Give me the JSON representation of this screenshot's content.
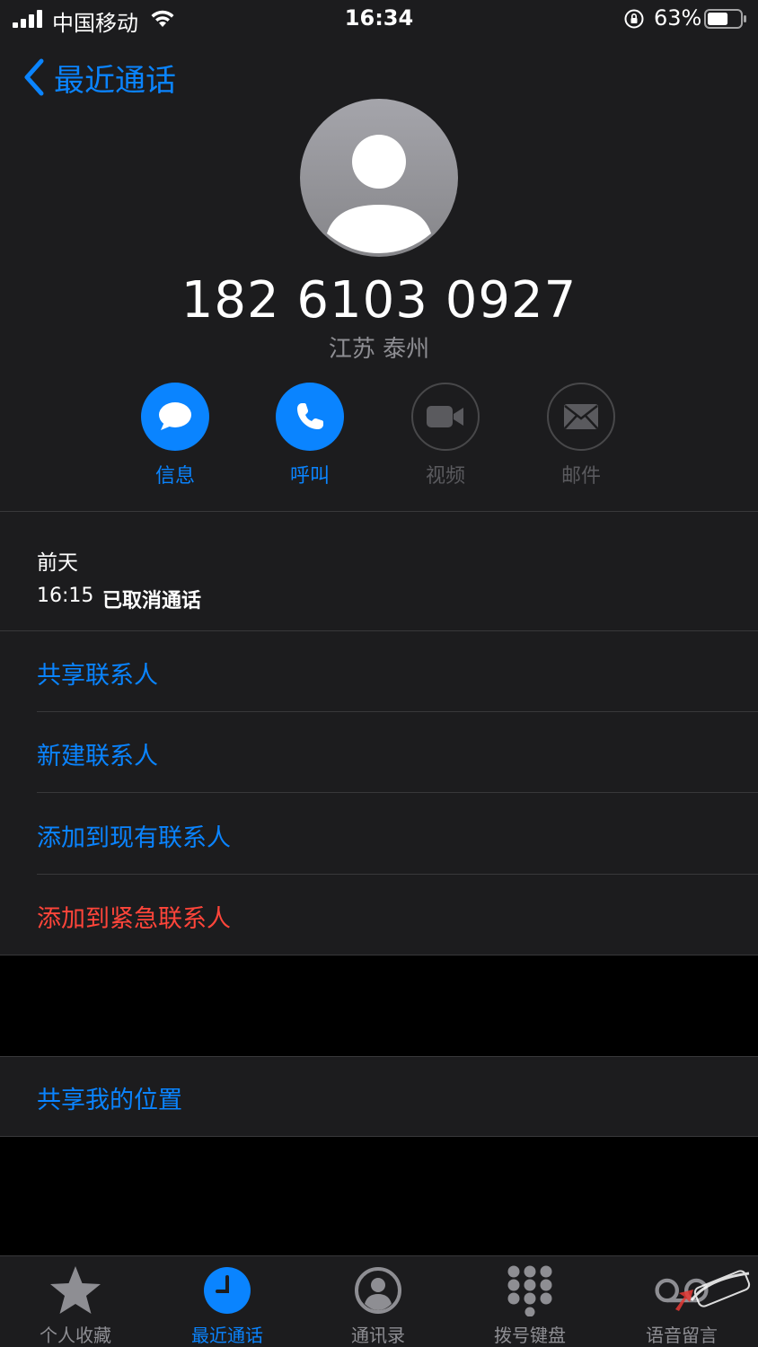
{
  "status_bar": {
    "carrier": "中国移动",
    "time": "16:34",
    "battery_percent": "63%",
    "battery_level": 0.63
  },
  "nav": {
    "back_label": "最近通话",
    "accent_color": "#0a84ff"
  },
  "contact": {
    "avatar_icon": "person-silhouette-icon",
    "phone_number": "182 6103 0927",
    "location": "江苏 泰州"
  },
  "actions": [
    {
      "label": "信息",
      "icon": "message-bubble-icon",
      "enabled": true
    },
    {
      "label": "呼叫",
      "icon": "phone-icon",
      "enabled": true
    },
    {
      "label": "视频",
      "icon": "video-camera-icon",
      "enabled": false
    },
    {
      "label": "邮件",
      "icon": "envelope-icon",
      "enabled": false
    }
  ],
  "recent_call": {
    "date": "前天",
    "time": "16:15",
    "status": "已取消通话"
  },
  "menu": {
    "share_contact": "共享联系人",
    "new_contact": "新建联系人",
    "add_existing": "添加到现有联系人",
    "add_emergency": "添加到紧急联系人",
    "share_location": "共享我的位置",
    "destructive_color": "#ff453a"
  },
  "tabs": [
    {
      "label": "个人收藏",
      "icon": "star-icon",
      "active": false
    },
    {
      "label": "最近通话",
      "icon": "clock-icon",
      "active": true
    },
    {
      "label": "通讯录",
      "icon": "contacts-icon",
      "active": false
    },
    {
      "label": "拨号键盘",
      "icon": "keypad-icon",
      "active": false
    },
    {
      "label": "语音留言",
      "icon": "voicemail-icon",
      "active": false
    }
  ]
}
